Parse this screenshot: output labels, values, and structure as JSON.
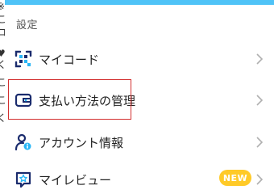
{
  "colors": {
    "accent_bar": "#4fc3f7",
    "icon_navy": "#1a2b6d",
    "icon_cyan": "#29b6f6",
    "highlight": "#d32f2f",
    "badge": "#ffca28",
    "chevron": "#b0b0b0"
  },
  "left_fragments": [
    "※",
    "こ",
    "コ",
    "♥",
    "く",
    "こ",
    "こ",
    "く"
  ],
  "settings": {
    "section_title": "設定",
    "items": [
      {
        "label": "マイコード",
        "icon": "qr-code-icon",
        "badge": ""
      },
      {
        "label": "支払い方法の管理",
        "icon": "wallet-icon",
        "badge": ""
      },
      {
        "label": "アカウント情報",
        "icon": "account-info-icon",
        "badge": ""
      },
      {
        "label": "マイレビュー",
        "icon": "review-star-icon",
        "badge": "NEW"
      }
    ]
  }
}
